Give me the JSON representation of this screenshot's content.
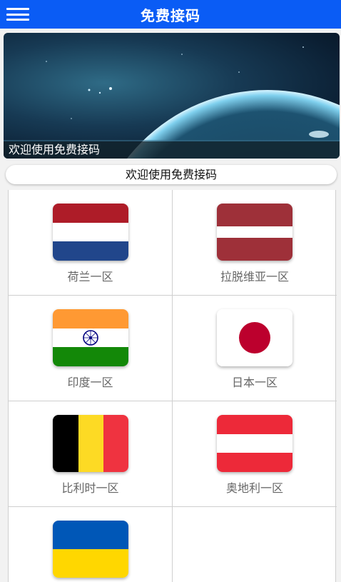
{
  "header": {
    "title": "免费接码",
    "menu_icon": "hamburger-menu-icon"
  },
  "banner": {
    "caption": "欢迎使用免费接码"
  },
  "welcome_button": {
    "label": "欢迎使用免费接码"
  },
  "regions": [
    {
      "label": "荷兰一区",
      "flag": "netherlands-flag-icon",
      "colors": [
        "#ae1c28",
        "#ffffff",
        "#21468b"
      ]
    },
    {
      "label": "拉脱维亚一区",
      "flag": "latvia-flag-icon",
      "colors": [
        "#9e3039",
        "#ffffff",
        "#9e3039"
      ]
    },
    {
      "label": "印度一区",
      "flag": "india-flag-icon",
      "colors": [
        "#ff9933",
        "#ffffff",
        "#138808"
      ]
    },
    {
      "label": "日本一区",
      "flag": "japan-flag-icon",
      "colors": [
        "#ffffff",
        "#bc002d"
      ]
    },
    {
      "label": "比利时一区",
      "flag": "belgium-flag-icon",
      "colors": [
        "#000000",
        "#fdda24",
        "#ef3340"
      ]
    },
    {
      "label": "奥地利一区",
      "flag": "austria-flag-icon",
      "colors": [
        "#ed2939",
        "#ffffff",
        "#ed2939"
      ]
    },
    {
      "label": "",
      "flag": "ukraine-flag-icon",
      "colors": [
        "#0057b7",
        "#ffd700"
      ]
    }
  ],
  "colors": {
    "header_bg": "#0a5cf5",
    "label_text": "#666666"
  }
}
